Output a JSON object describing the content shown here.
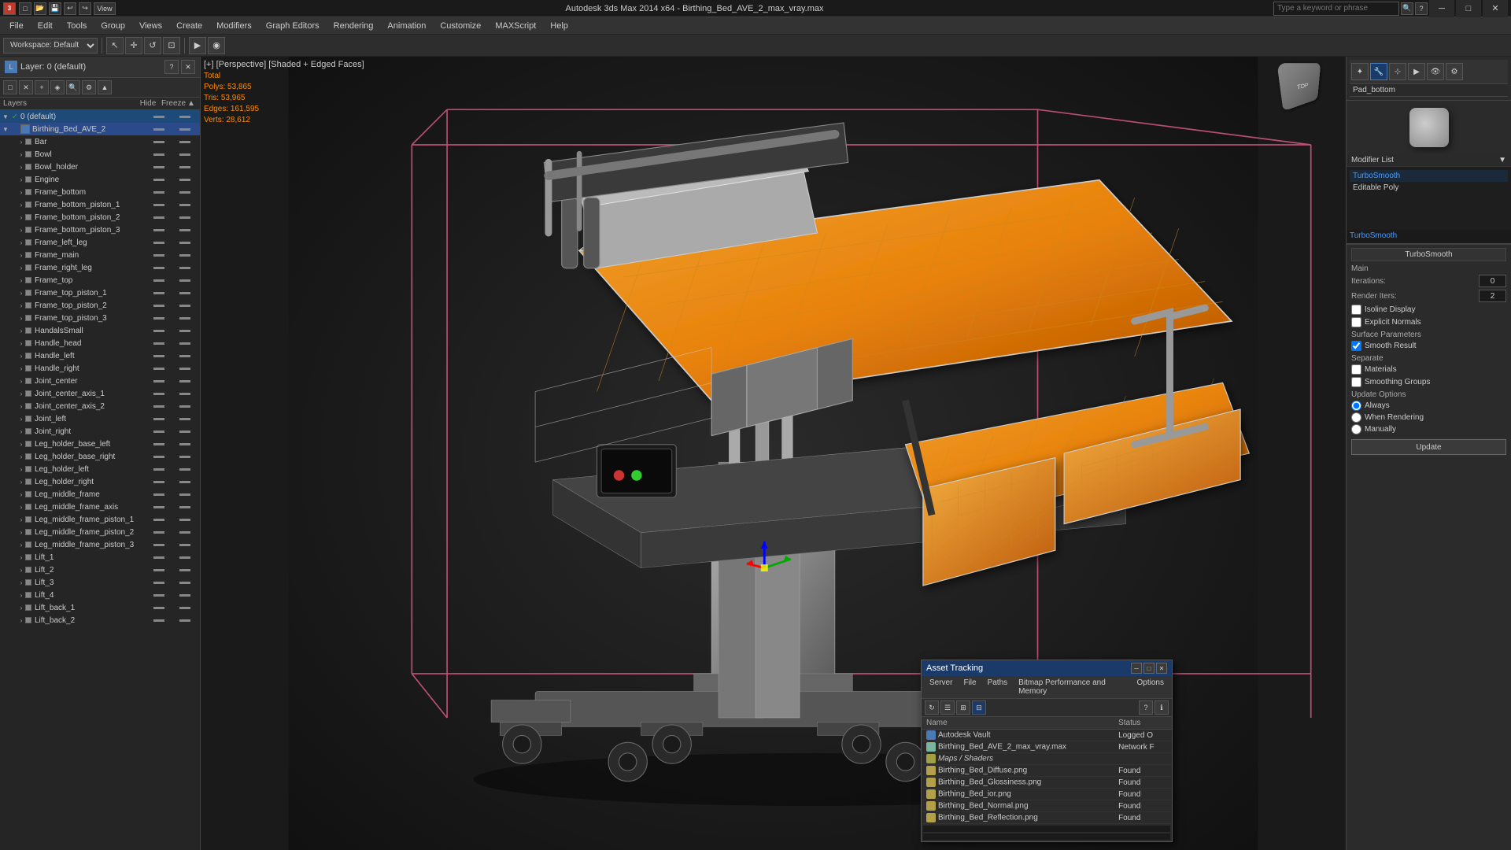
{
  "app": {
    "title": "Autodesk 3ds Max 2014 x64 - Birthing_Bed_AVE_2_max_vray.max",
    "workspace": "Workspace: Default"
  },
  "menu": {
    "items": [
      "File",
      "Edit",
      "Tools",
      "Group",
      "Views",
      "Create",
      "Modifiers",
      "Graph Editors",
      "Rendering",
      "Animation",
      "Customize",
      "MAXScript",
      "Help"
    ]
  },
  "search": {
    "placeholder": "Type a keyword or phrase"
  },
  "viewport": {
    "label": "[+] [Perspective] [Shaded + Edged Faces]",
    "stats": {
      "total_label": "Total",
      "polys_label": "Polys:",
      "polys_value": "53,865",
      "tris_label": "Tris:",
      "tris_value": "53,965",
      "edges_label": "Edges:",
      "edges_value": "161,595",
      "verts_label": "Verts:",
      "verts_value": "28,612"
    }
  },
  "layer_panel": {
    "title": "Layer: 0 (default)",
    "col_layers": "Layers",
    "col_hide": "Hide",
    "col_freeze": "Freeze",
    "items": [
      {
        "indent": 0,
        "name": "0 (default)",
        "check": "✓",
        "level": 0
      },
      {
        "indent": 0,
        "name": "Birthing_Bed_AVE_2",
        "check": "",
        "level": 0,
        "selected": true
      },
      {
        "indent": 1,
        "name": "Bar",
        "check": "",
        "level": 1
      },
      {
        "indent": 1,
        "name": "Bowl",
        "check": "",
        "level": 1
      },
      {
        "indent": 1,
        "name": "Bowl_holder",
        "check": "",
        "level": 1
      },
      {
        "indent": 1,
        "name": "Engine",
        "check": "",
        "level": 1
      },
      {
        "indent": 1,
        "name": "Frame_bottom",
        "check": "",
        "level": 1
      },
      {
        "indent": 1,
        "name": "Frame_bottom_piston_1",
        "check": "",
        "level": 1
      },
      {
        "indent": 1,
        "name": "Frame_bottom_piston_2",
        "check": "",
        "level": 1
      },
      {
        "indent": 1,
        "name": "Frame_bottom_piston_3",
        "check": "",
        "level": 1
      },
      {
        "indent": 1,
        "name": "Frame_left_leg",
        "check": "",
        "level": 1
      },
      {
        "indent": 1,
        "name": "Frame_main",
        "check": "",
        "level": 1
      },
      {
        "indent": 1,
        "name": "Frame_right_leg",
        "check": "",
        "level": 1
      },
      {
        "indent": 1,
        "name": "Frame_top",
        "check": "",
        "level": 1
      },
      {
        "indent": 1,
        "name": "Frame_top_piston_1",
        "check": "",
        "level": 1
      },
      {
        "indent": 1,
        "name": "Frame_top_piston_2",
        "check": "",
        "level": 1
      },
      {
        "indent": 1,
        "name": "Frame_top_piston_3",
        "check": "",
        "level": 1
      },
      {
        "indent": 1,
        "name": "HandalsSmall",
        "check": "",
        "level": 1
      },
      {
        "indent": 1,
        "name": "Handle_head",
        "check": "",
        "level": 1
      },
      {
        "indent": 1,
        "name": "Handle_left",
        "check": "",
        "level": 1
      },
      {
        "indent": 1,
        "name": "Handle_right",
        "check": "",
        "level": 1
      },
      {
        "indent": 1,
        "name": "Joint_center",
        "check": "",
        "level": 1
      },
      {
        "indent": 1,
        "name": "Joint_center_axis_1",
        "check": "",
        "level": 1
      },
      {
        "indent": 1,
        "name": "Joint_center_axis_2",
        "check": "",
        "level": 1
      },
      {
        "indent": 1,
        "name": "Joint_left",
        "check": "",
        "level": 1
      },
      {
        "indent": 1,
        "name": "Joint_right",
        "check": "",
        "level": 1
      },
      {
        "indent": 1,
        "name": "Leg_holder_base_left",
        "check": "",
        "level": 1
      },
      {
        "indent": 1,
        "name": "Leg_holder_base_right",
        "check": "",
        "level": 1
      },
      {
        "indent": 1,
        "name": "Leg_holder_left",
        "check": "",
        "level": 1
      },
      {
        "indent": 1,
        "name": "Leg_holder_right",
        "check": "",
        "level": 1
      },
      {
        "indent": 1,
        "name": "Leg_middle_frame",
        "check": "",
        "level": 1
      },
      {
        "indent": 1,
        "name": "Leg_middle_frame_axis",
        "check": "",
        "level": 1
      },
      {
        "indent": 1,
        "name": "Leg_middle_frame_piston_1",
        "check": "",
        "level": 1
      },
      {
        "indent": 1,
        "name": "Leg_middle_frame_piston_2",
        "check": "",
        "level": 1
      },
      {
        "indent": 1,
        "name": "Leg_middle_frame_piston_3",
        "check": "",
        "level": 1
      },
      {
        "indent": 1,
        "name": "Lift_1",
        "check": "",
        "level": 1
      },
      {
        "indent": 1,
        "name": "Lift_2",
        "check": "",
        "level": 1
      },
      {
        "indent": 1,
        "name": "Lift_3",
        "check": "",
        "level": 1
      },
      {
        "indent": 1,
        "name": "Lift_4",
        "check": "",
        "level": 1
      },
      {
        "indent": 1,
        "name": "Lift_back_1",
        "check": "",
        "level": 1
      },
      {
        "indent": 1,
        "name": "Lift_back_2",
        "check": "",
        "level": 1
      }
    ]
  },
  "right_panel": {
    "object_name": "Pad_bottom",
    "modifier_list_label": "Modifier List",
    "modifier_dropdown_arrow": "▼",
    "modifiers": [
      {
        "name": "TurboSmooth",
        "active": true
      },
      {
        "name": "Editable Poly",
        "active": false,
        "sub": false
      }
    ],
    "turbosmooth": {
      "section_title": "TurboSmooth",
      "main_label": "Main",
      "iterations_label": "Iterations:",
      "iterations_value": "0",
      "render_iters_label": "Render Iters:",
      "render_iters_value": "2",
      "isoline_display_label": "Isoline Display",
      "explicit_normals_label": "Explicit Normals",
      "surface_params_label": "Surface Parameters",
      "smooth_result_label": "Smooth Result",
      "separate_label": "Separate",
      "materials_label": "Materials",
      "smoothing_groups_label": "Smoothing Groups",
      "update_options_label": "Update Options",
      "always_label": "Always",
      "when_rendering_label": "When Rendering",
      "manually_label": "Manually",
      "update_btn": "Update"
    }
  },
  "asset_tracking": {
    "title": "Asset Tracking",
    "menus": [
      "Server",
      "File",
      "Paths",
      "Bitmap Performance and Memory",
      "Options"
    ],
    "col_name": "Name",
    "col_status": "Status",
    "items": [
      {
        "indent": 0,
        "type": "vault",
        "name": "Autodesk Vault",
        "status": "Logged O"
      },
      {
        "indent": 1,
        "type": "file",
        "name": "Birthing_Bed_AVE_2_max_vray.max",
        "status": "Network F"
      },
      {
        "indent": 2,
        "type": "folder",
        "name": "Maps / Shaders",
        "status": ""
      },
      {
        "indent": 3,
        "type": "asset",
        "name": "Birthing_Bed_Diffuse.png",
        "status": "Found"
      },
      {
        "indent": 3,
        "type": "asset",
        "name": "Birthing_Bed_Glossiness.png",
        "status": "Found"
      },
      {
        "indent": 3,
        "type": "asset",
        "name": "Birthing_Bed_ior.png",
        "status": "Found"
      },
      {
        "indent": 3,
        "type": "asset",
        "name": "Birthing_Bed_Normal.png",
        "status": "Found"
      },
      {
        "indent": 3,
        "type": "asset",
        "name": "Birthing_Bed_Reflection.png",
        "status": "Found"
      }
    ]
  },
  "icons": {
    "save": "💾",
    "open": "📂",
    "undo": "↩",
    "redo": "↪",
    "close": "✕",
    "minimize": "─",
    "maximize": "□",
    "expand": "►",
    "collapse": "▼",
    "check": "✓",
    "search": "🔍",
    "gear": "⚙"
  },
  "colors": {
    "accent_blue": "#1a3a6a",
    "highlight": "#2a5a9a",
    "orange": "#ff8c00",
    "bed_orange": "#e8820a",
    "wire_color": "#cccccc",
    "bg_dark": "#1a1a1a"
  }
}
